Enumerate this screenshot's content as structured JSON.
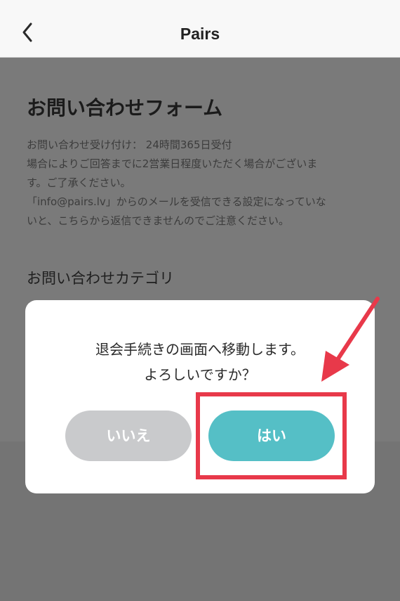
{
  "header": {
    "title": "Pairs"
  },
  "form": {
    "title": "お問い合わせフォーム",
    "notes": [
      "お問い合わせ受け付け： 24時間365日受付",
      "場合によりご回答までに2営業日程度いただく場合がございま",
      "す。ご了承ください。",
      "「info@pairs.lv」からのメールを受信できる設定になっていな",
      "いと、こちらから返信できませんのでご注意ください。"
    ],
    "category_label": "お問い合わせカテゴリ"
  },
  "dialog": {
    "message_lines": [
      "退会手続きの画面へ移動します。",
      "よろしいですか？"
    ],
    "no_label": "いいえ",
    "yes_label": "はい"
  },
  "colors": {
    "overlay": "#7a7a7a",
    "yes_button": "#55bfc6",
    "no_button": "#c9cacc",
    "annotation_red": "#e8394a"
  }
}
